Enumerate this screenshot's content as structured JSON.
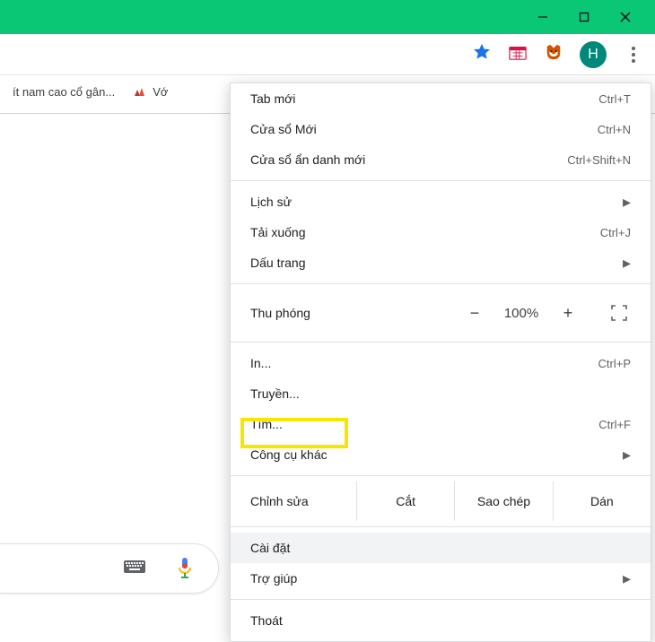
{
  "window_controls": {
    "minimize": "minimize",
    "maximize": "maximize",
    "close": "close"
  },
  "toolbar": {
    "star": "bookmark-star",
    "ext_calendar": "calendar-extension",
    "ext_panda": "panda-extension",
    "avatar_letter": "H",
    "menu": "menu"
  },
  "bookmarks": {
    "item1": "ít nam cao cổ gân...",
    "item2_partial": "Vớ"
  },
  "search": {
    "keyboard": "keyboard-icon",
    "mic": "mic-icon"
  },
  "menu": {
    "new_tab": {
      "label": "Tab mới",
      "shortcut": "Ctrl+T"
    },
    "new_window": {
      "label": "Cửa sổ Mới",
      "shortcut": "Ctrl+N"
    },
    "incognito": {
      "label": "Cửa sổ ẩn danh mới",
      "shortcut": "Ctrl+Shift+N"
    },
    "history": {
      "label": "Lịch sử"
    },
    "downloads": {
      "label": "Tải xuống",
      "shortcut": "Ctrl+J"
    },
    "bookmarks": {
      "label": "Dấu trang"
    },
    "zoom": {
      "label": "Thu phóng",
      "minus": "−",
      "pct": "100%",
      "plus": "+"
    },
    "print": {
      "label": "In...",
      "shortcut": "Ctrl+P"
    },
    "cast": {
      "label": "Truyền..."
    },
    "find": {
      "label": "Tìm...",
      "shortcut": "Ctrl+F"
    },
    "more_tools": {
      "label": "Công cụ khác"
    },
    "edit": {
      "label": "Chỉnh sửa",
      "cut": "Cắt",
      "copy": "Sao chép",
      "paste": "Dán"
    },
    "settings": {
      "label": "Cài đặt"
    },
    "help": {
      "label": "Trợ giúp"
    },
    "exit": {
      "label": "Thoát"
    }
  }
}
